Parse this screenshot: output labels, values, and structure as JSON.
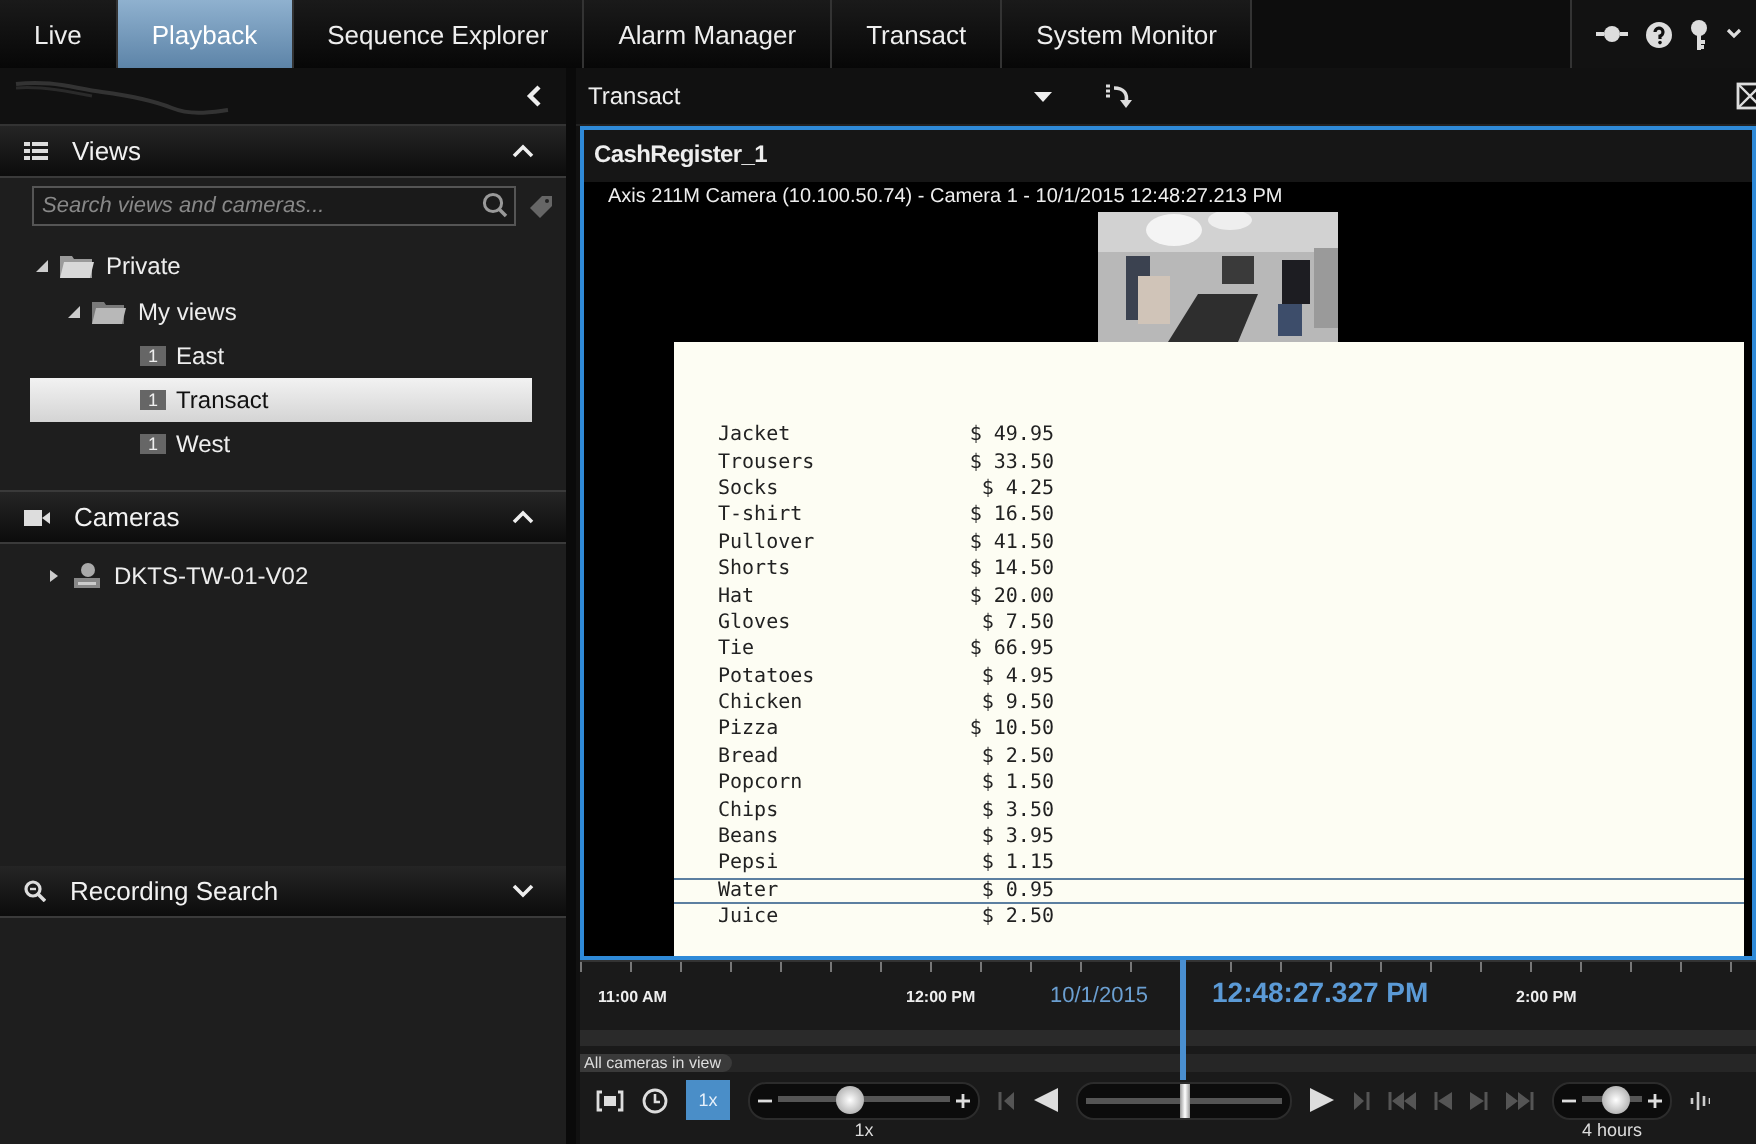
{
  "tabs": [
    {
      "label": "Live",
      "selected": false
    },
    {
      "label": "Playback",
      "selected": true
    },
    {
      "label": "Sequence Explorer",
      "selected": false
    },
    {
      "label": "Alarm Manager",
      "selected": false
    },
    {
      "label": "Transact",
      "selected": false
    },
    {
      "label": "System Monitor",
      "selected": false
    }
  ],
  "toolbar": {
    "view_selector": "Transact"
  },
  "sidebar": {
    "views": {
      "title": "Views",
      "expanded": true,
      "search": {
        "placeholder": "Search views and cameras..."
      },
      "tree": [
        {
          "label": "Private",
          "kind": "folder",
          "expanded": true,
          "selected": false,
          "children": [
            {
              "label": "My views",
              "kind": "folder",
              "expanded": true,
              "selected": false,
              "children": [
                {
                  "label": "East",
                  "kind": "view",
                  "badge": "1",
                  "selected": false
                },
                {
                  "label": "Transact",
                  "kind": "view",
                  "badge": "1",
                  "selected": true
                },
                {
                  "label": "West",
                  "kind": "view",
                  "badge": "1",
                  "selected": false
                }
              ]
            }
          ]
        }
      ]
    },
    "cameras": {
      "title": "Cameras",
      "expanded": true,
      "items": [
        {
          "label": "DKTS-TW-01-V02",
          "expanded": false
        }
      ]
    },
    "recording_search": {
      "title": "Recording Search",
      "expanded": false
    }
  },
  "viewer": {
    "title": "CashRegister_1",
    "camera_info": "Axis 211M Camera (10.100.50.74) - Camera 1 - 10/1/2015 12:48:27.213 PM",
    "receipt": [
      {
        "item": "Jacket",
        "price": "$ 49.95",
        "highlighted": false
      },
      {
        "item": "Trousers",
        "price": "$ 33.50",
        "highlighted": false
      },
      {
        "item": "Socks",
        "price": "$ 4.25",
        "highlighted": false
      },
      {
        "item": "T-shirt",
        "price": "$ 16.50",
        "highlighted": false
      },
      {
        "item": "Pullover",
        "price": "$ 41.50",
        "highlighted": false
      },
      {
        "item": "Shorts",
        "price": "$ 14.50",
        "highlighted": false
      },
      {
        "item": "Hat",
        "price": "$ 20.00",
        "highlighted": false
      },
      {
        "item": "Gloves",
        "price": "$ 7.50",
        "highlighted": false
      },
      {
        "item": "Tie",
        "price": "$ 66.95",
        "highlighted": false
      },
      {
        "item": "Potatoes",
        "price": "$ 4.95",
        "highlighted": false
      },
      {
        "item": "Chicken",
        "price": "$ 9.50",
        "highlighted": false
      },
      {
        "item": "Pizza",
        "price": "$ 10.50",
        "highlighted": false
      },
      {
        "item": "Bread",
        "price": "$ 2.50",
        "highlighted": false
      },
      {
        "item": "Popcorn",
        "price": "$ 1.50",
        "highlighted": false
      },
      {
        "item": "Chips",
        "price": "$ 3.50",
        "highlighted": false
      },
      {
        "item": "Beans",
        "price": "$ 3.95",
        "highlighted": false
      },
      {
        "item": "Pepsi",
        "price": "$ 1.15",
        "highlighted": false
      },
      {
        "item": "Water",
        "price": "$ 0.95",
        "highlighted": true
      },
      {
        "item": "Juice",
        "price": "$ 2.50",
        "highlighted": false
      }
    ]
  },
  "timeline": {
    "labels": [
      "11:00 AM",
      "12:00 PM",
      "2:00 PM"
    ],
    "date": "10/1/2015",
    "current_time": "12:48:27.327 PM",
    "scope": "All cameras in view",
    "speed_button": {
      "label": "1x",
      "selected": true
    },
    "speed": {
      "level": 0.42,
      "reading": "1x"
    },
    "jog": {
      "level": 0.5
    },
    "zoom": {
      "level": 0.55,
      "reading": "4 hours"
    }
  }
}
